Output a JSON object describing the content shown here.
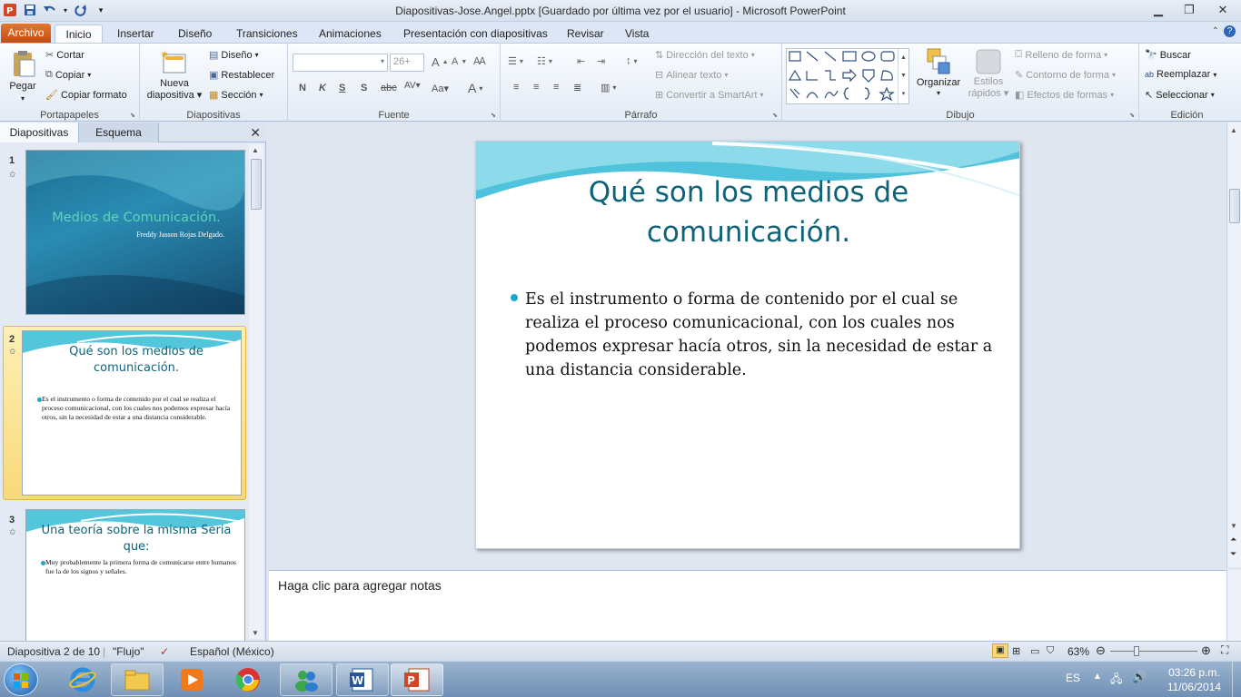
{
  "window": {
    "title": "Diapositivas-Jose.Angel.pptx [Guardado por última vez por el usuario]  -  Microsoft PowerPoint"
  },
  "tabs": [
    "Archivo",
    "Inicio",
    "Insertar",
    "Diseño",
    "Transiciones",
    "Animaciones",
    "Presentación con diapositivas",
    "Revisar",
    "Vista"
  ],
  "ribbon": {
    "clipboard": {
      "label": "Portapapeles",
      "paste": "Pegar",
      "cut": "Cortar",
      "copy": "Copiar",
      "format_painter": "Copiar formato"
    },
    "slides": {
      "label": "Diapositivas",
      "new_slide_1": "Nueva",
      "new_slide_2": "diapositiva",
      "layout": "Diseño",
      "reset": "Restablecer",
      "section": "Sección"
    },
    "font": {
      "label": "Fuente",
      "font_name": "",
      "font_size": "26+"
    },
    "paragraph": {
      "label": "Párrafo",
      "text_direction": "Dirección del texto",
      "align_text": "Alinear texto",
      "smartart": "Convertir a SmartArt"
    },
    "drawing": {
      "label": "Dibujo",
      "arrange": "Organizar",
      "quick_styles_1": "Estilos",
      "quick_styles_2": "rápidos",
      "shape_fill": "Relleno de forma",
      "shape_outline": "Contorno de forma",
      "shape_effects": "Efectos de formas"
    },
    "editing": {
      "label": "Edición",
      "find": "Buscar",
      "replace": "Reemplazar",
      "select": "Seleccionar"
    }
  },
  "left_pane": {
    "tabs": [
      "Diapositivas",
      "Esquema"
    ],
    "thumbnails": [
      {
        "number": "1",
        "title": "Medios de Comunicación.",
        "subtitle": "Freddy Jasson Rojas Delgado."
      },
      {
        "number": "2",
        "title": "Qué son los medios de comunicación.",
        "body": "Es el instrumento o forma de contenido por el cual se realiza el proceso comunicacional, con los cuales nos podemos expresar hacía otros, sin la necesidad de estar a una distancia considerable."
      },
      {
        "number": "3",
        "title": "Una teoría sobre la misma Seria que:",
        "body": "Muy probablemente la primera forma de comunicarse entre humanos fue la de los signos y señales."
      }
    ]
  },
  "slide": {
    "title": "Qué son los medios de comunicación.",
    "body": "Es el instrumento o forma de contenido por el cual se realiza el proceso comunicacional, con los cuales nos podemos expresar hacía otros, sin la necesidad de estar a una distancia considerable."
  },
  "notes": {
    "placeholder": "Haga clic para agregar notas"
  },
  "status": {
    "slide_info": "Diapositiva 2 de 10",
    "theme": "\"Flujo\"",
    "language": "Español (México)",
    "zoom": "63%"
  },
  "taskbar": {
    "lang": "ES",
    "time": "03:26 p.m.",
    "date": "11/06/2014"
  },
  "colors": {
    "title_teal": "#0e6379",
    "bullet_cyan": "#1aa6cd",
    "file_tab": "#d2561a"
  }
}
